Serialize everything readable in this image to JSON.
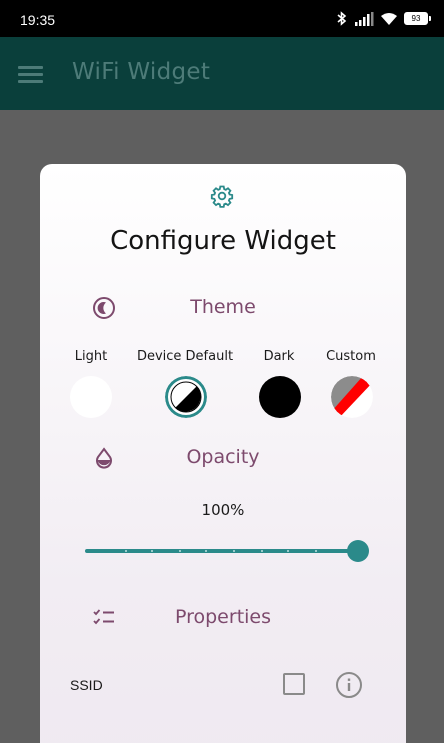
{
  "status_bar": {
    "time": "19:35",
    "battery": "93",
    "icons": [
      "bluetooth-icon",
      "signal-icon",
      "wifi-icon",
      "battery-icon"
    ]
  },
  "app_bar": {
    "title": "WiFi Widget",
    "menu_icon": "menu-icon"
  },
  "dialog": {
    "title": "Configure Widget",
    "header_icon": "gear-icon",
    "theme": {
      "label": "Theme",
      "icon": "theme-icon",
      "options": [
        {
          "label": "Light",
          "color": "#ffffff",
          "selected": false
        },
        {
          "label": "Device Default",
          "color": "#000000/#ffffff",
          "selected": true
        },
        {
          "label": "Dark",
          "color": "#000000",
          "selected": false
        },
        {
          "label": "Custom",
          "color": "#ff0000/#808080",
          "selected": false
        }
      ]
    },
    "opacity": {
      "label": "Opacity",
      "icon": "droplet-icon",
      "value": "100%",
      "fraction": 1.0
    },
    "properties": {
      "label": "Properties",
      "icon": "checklist-icon",
      "items": [
        {
          "label": "SSID",
          "checked": false,
          "info_icon": "info-icon"
        }
      ]
    }
  },
  "colors": {
    "accent": "#2b8a8a",
    "section_label": "#7d4a6d",
    "app_bar": "#0a3f3b"
  }
}
